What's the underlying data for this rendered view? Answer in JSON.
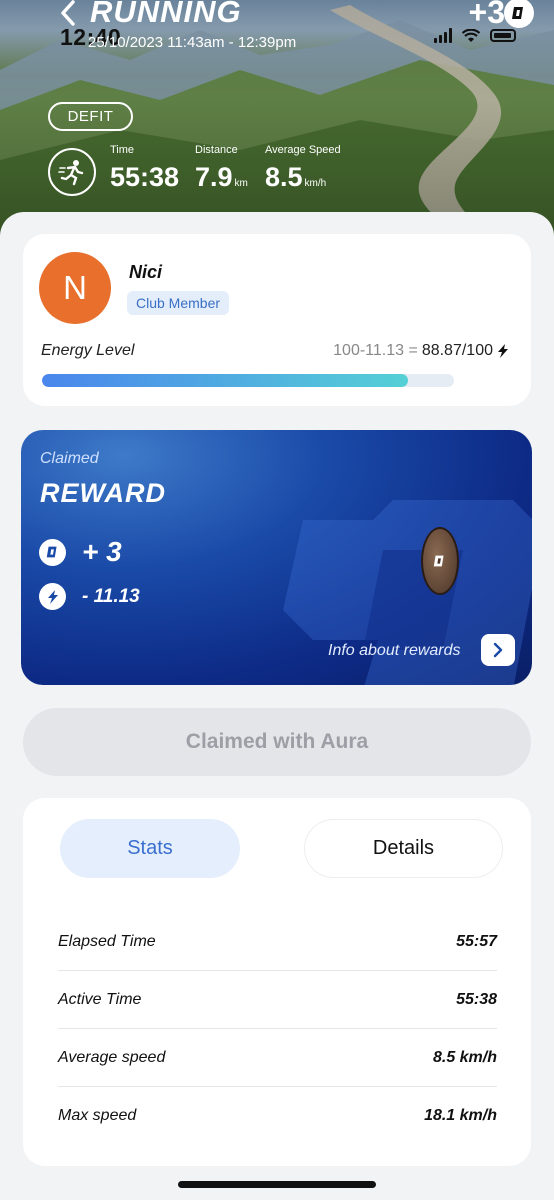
{
  "status_bar": {
    "time": "12:40"
  },
  "header": {
    "title": "RUNNING",
    "date": "25/10/2023 11:43am - 12:39pm",
    "reward_total": "+3",
    "badge": "DEFIT"
  },
  "metrics": [
    {
      "label": "Time",
      "value": "55:38",
      "unit": ""
    },
    {
      "label": "Distance",
      "value": "7.9",
      "unit": "km"
    },
    {
      "label": "Average Speed",
      "value": "8.5",
      "unit": "km/h"
    }
  ],
  "profile": {
    "initial": "N",
    "name": "Nici",
    "badge": "Club Member",
    "energy_label": "Energy Level",
    "energy_formula": "100-11.13 =",
    "energy_value": "88.87/100",
    "energy_fraction": 0.8887
  },
  "reward": {
    "claimed_label": "Claimed",
    "title": "REWARD",
    "coins": "+ 3",
    "energy_cost": "- 11.13",
    "info_label": "Info about rewards"
  },
  "claim_button": {
    "label": "Claimed with Aura"
  },
  "tabs": [
    {
      "label": "Stats",
      "active": true
    },
    {
      "label": "Details",
      "active": false
    }
  ],
  "stats": [
    {
      "label": "Elapsed Time",
      "value": "55:57"
    },
    {
      "label": "Active Time",
      "value": "55:38"
    },
    {
      "label": "Average speed",
      "value": "8.5 km/h"
    },
    {
      "label": "Max speed",
      "value": "18.1 km/h"
    }
  ],
  "colors": {
    "accent_blue": "#3a6fd0",
    "avatar_orange": "#e8702c",
    "reward_card": "#1a4aa8"
  },
  "icons": [
    "back-icon",
    "dash-coin-icon",
    "signal-icon",
    "wifi-icon",
    "battery-icon",
    "runner-icon",
    "bolt-icon",
    "chevron-right-icon"
  ]
}
